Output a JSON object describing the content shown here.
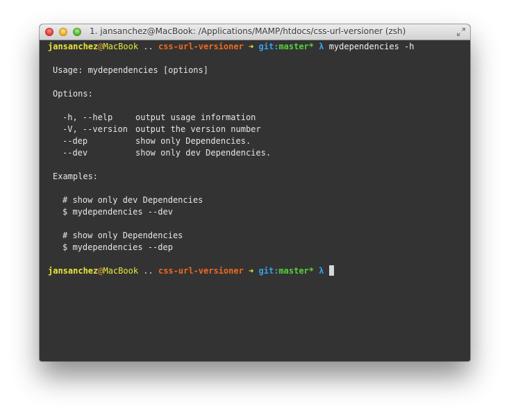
{
  "window": {
    "title": "1. jansanchez@MacBook: /Applications/MAMP/htdocs/css-url-versioner (zsh)"
  },
  "prompt": {
    "user": "jansanchez",
    "at": "@",
    "host": "MacBook",
    "separator": "..",
    "directory": "css-url-versioner",
    "arrow": "➜",
    "git_label": "git:",
    "branch": "master*",
    "lambda": "λ"
  },
  "command": "mydependencies -h",
  "output": {
    "usage": "Usage: mydependencies [options]",
    "options_heading": "Options:",
    "options": [
      {
        "flag": "-h, --help",
        "desc": "output usage information"
      },
      {
        "flag": "-V, --version",
        "desc": "output the version number"
      },
      {
        "flag": "--dep",
        "desc": "show only Dependencies."
      },
      {
        "flag": "--dev",
        "desc": "show only dev Dependencies."
      }
    ],
    "examples_heading": "Examples:",
    "examples": [
      {
        "comment": "# show only dev Dependencies",
        "command": "$ mydependencies --dev"
      },
      {
        "comment": "# show only Dependencies",
        "command": "$ mydependencies --dep"
      }
    ]
  },
  "icons": {
    "close": "close-button",
    "minimize": "minimize-button",
    "zoom": "zoom-button",
    "fullscreen": "fullscreen-icon"
  },
  "colors": {
    "terminal_bg": "#333333",
    "user": "#e8e83a",
    "directory": "#f06a1e",
    "git": "#3aa0e8",
    "branch": "#57d23a"
  }
}
